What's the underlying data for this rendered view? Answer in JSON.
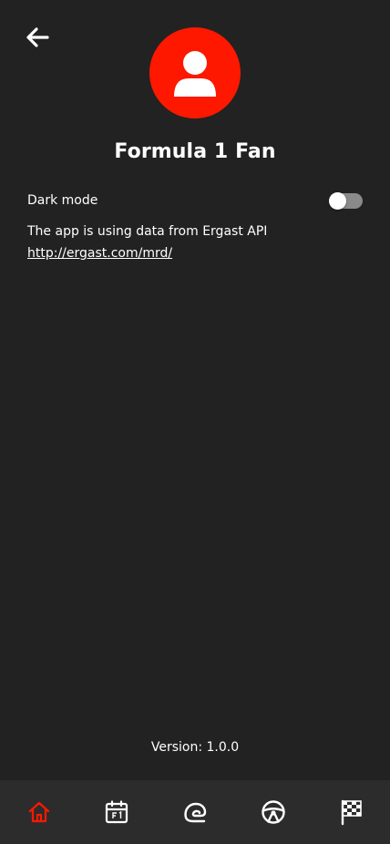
{
  "profile": {
    "name": "Formula 1 Fan"
  },
  "settings": {
    "dark_mode_label": "Dark mode",
    "dark_mode_enabled": false
  },
  "info": {
    "data_source_text": "The app is using data from Ergast API",
    "data_source_link": "http://ergast.com/mrd/"
  },
  "footer": {
    "version": "Version: 1.0.0"
  },
  "colors": {
    "accent": "#ff1800",
    "background": "#222222",
    "nav_background": "#2c2c2c",
    "text": "#ffffff"
  },
  "bottom_nav": {
    "items": [
      {
        "icon": "home-icon",
        "active": true
      },
      {
        "icon": "calendar-f1-icon",
        "active": false
      },
      {
        "icon": "circuit-icon",
        "active": false
      },
      {
        "icon": "steering-wheel-icon",
        "active": false
      },
      {
        "icon": "checkered-flag-icon",
        "active": false
      }
    ]
  }
}
